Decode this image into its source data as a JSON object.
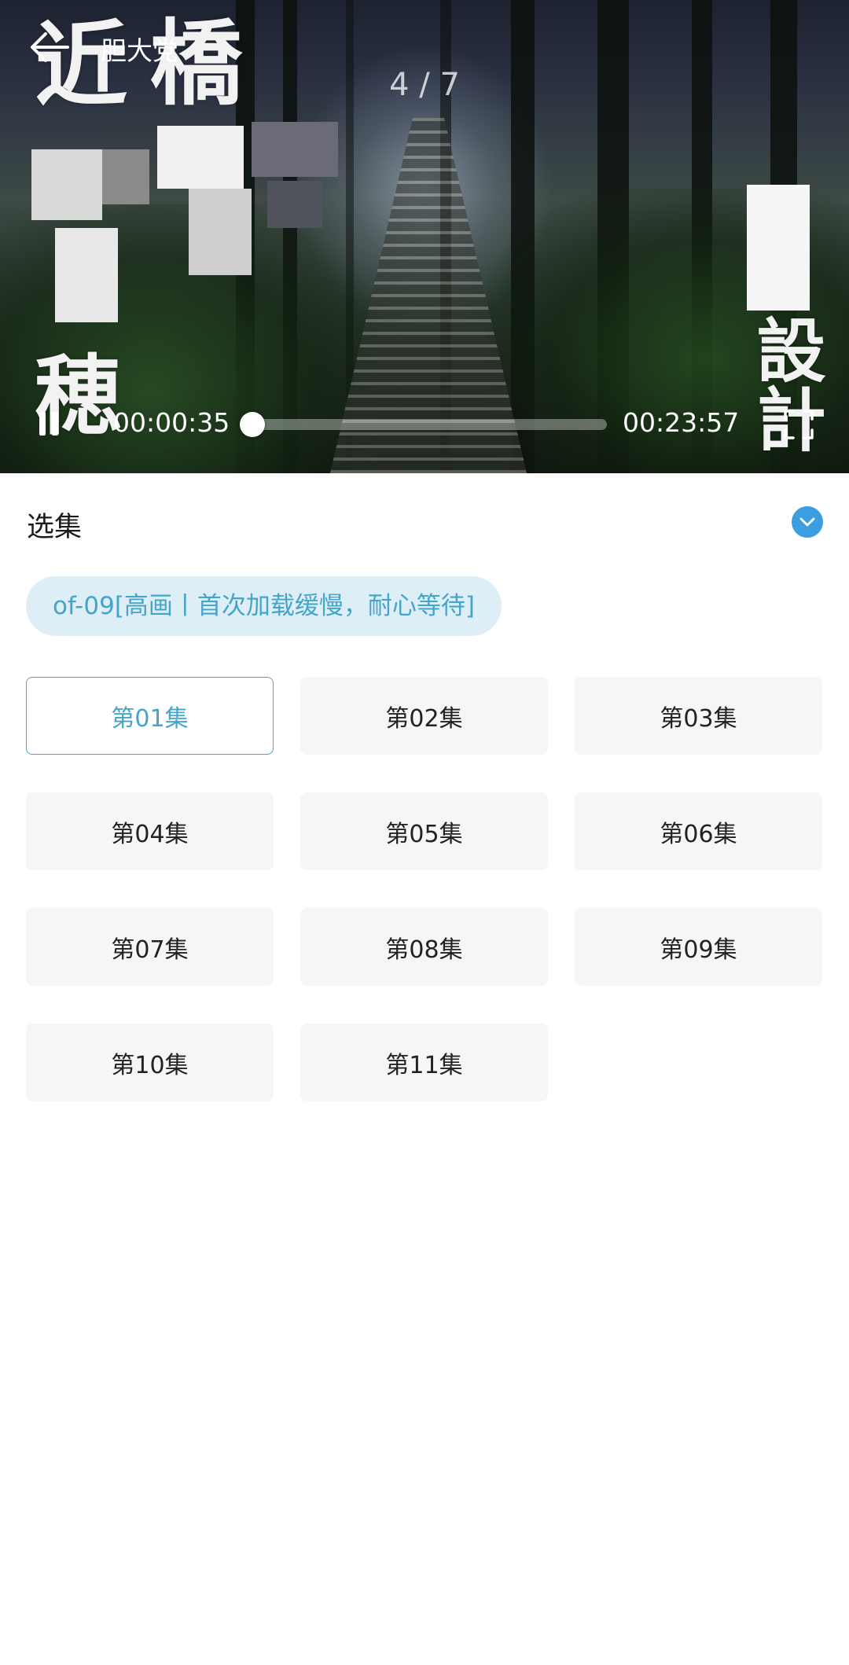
{
  "player": {
    "title": "胆大党",
    "slide_counter": "4 / 7",
    "current_time": "00:00:35",
    "total_time": "00:23:57",
    "progress_fraction": 0.024,
    "state": "playing",
    "overlay_text": {
      "left_column_1": "近",
      "left_column_1b": "穂",
      "left_column_2": "橋",
      "right_column": "設計"
    }
  },
  "episodes": {
    "section_title": "选集",
    "source_label": "of-09[高画丨首次加载缓慢，耐心等待]",
    "accent_color": "#45a5c9",
    "collapse_icon": "chevron-down-icon",
    "selected_index": 0,
    "items": [
      {
        "label": "第01集"
      },
      {
        "label": "第02集"
      },
      {
        "label": "第03集"
      },
      {
        "label": "第04集"
      },
      {
        "label": "第05集"
      },
      {
        "label": "第06集"
      },
      {
        "label": "第07集"
      },
      {
        "label": "第08集"
      },
      {
        "label": "第09集"
      },
      {
        "label": "第10集"
      },
      {
        "label": "第11集"
      }
    ]
  }
}
